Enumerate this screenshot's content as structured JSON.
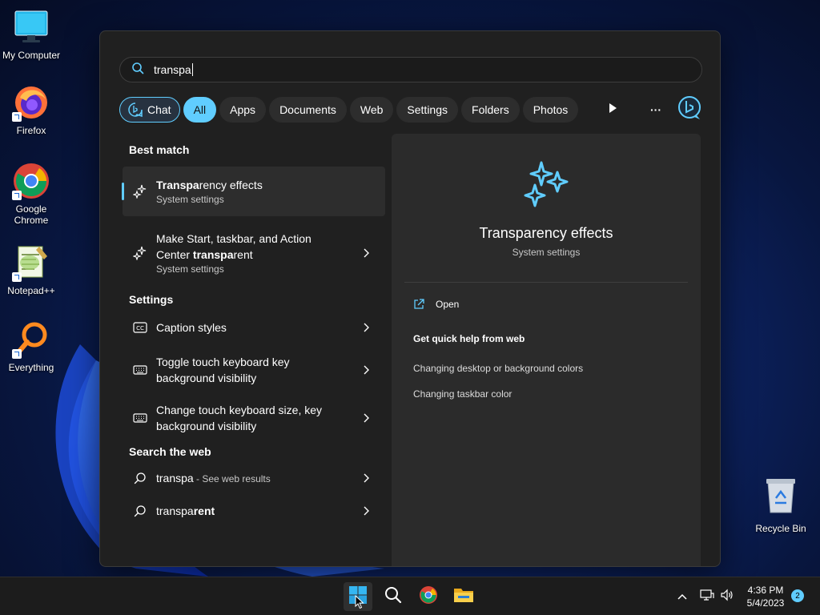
{
  "desktop": {
    "icons": [
      {
        "label": "My Computer"
      },
      {
        "label": "Firefox"
      },
      {
        "label": "Google Chrome"
      },
      {
        "label": "Notepad++"
      },
      {
        "label": "Everything"
      }
    ],
    "recycle_bin": {
      "label": "Recycle Bin"
    }
  },
  "search": {
    "query": "transpa"
  },
  "filters": {
    "chat": "Chat",
    "all": "All",
    "apps": "Apps",
    "documents": "Documents",
    "web": "Web",
    "settings": "Settings",
    "folders": "Folders",
    "photos": "Photos",
    "more": "···"
  },
  "sections": {
    "best_match": "Best match",
    "settings": "Settings",
    "search_web": "Search the web"
  },
  "best_match": {
    "title_bold": "Transpa",
    "title_rest": "rency effects",
    "subtitle": "System settings"
  },
  "second_result": {
    "line1": "Make Start, taskbar, and Action",
    "line2_prefix": "Center ",
    "line2_bold": "transpa",
    "line2_rest": "rent",
    "subtitle": "System settings"
  },
  "settings_results": [
    {
      "line1": "Caption styles",
      "line2": ""
    },
    {
      "line1": "Toggle touch keyboard key",
      "line2": "background visibility"
    },
    {
      "line1": "Change touch keyboard size, key",
      "line2": "background visibility"
    }
  ],
  "web_results": [
    {
      "query": "transpa",
      "suffix": " - See web results"
    },
    {
      "query_prefix": "transpa",
      "query_bold": "rent"
    }
  ],
  "preview": {
    "title": "Transparency effects",
    "subtitle": "System settings",
    "open": "Open",
    "quick_help": "Get quick help from web",
    "links": [
      "Changing desktop or background colors",
      "Changing taskbar color"
    ]
  },
  "taskbar": {
    "time": "4:36 PM",
    "date": "5/4/2023",
    "notification_count": "2"
  },
  "colors": {
    "accent": "#60cdff",
    "panel": "#202020",
    "preview_pane": "#2b2b2b"
  }
}
